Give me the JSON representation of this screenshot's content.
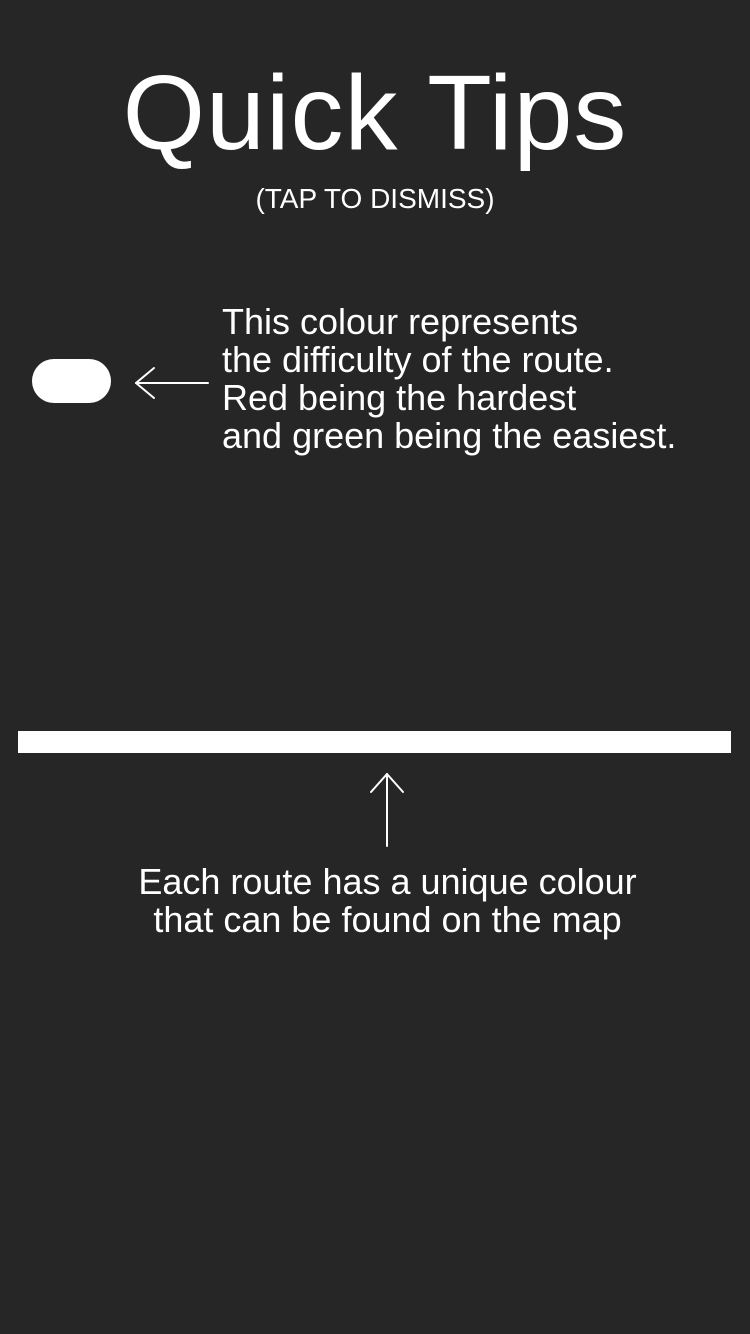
{
  "title": "Quick Tips",
  "subtitle": "(TAP TO DISMISS)",
  "difficulty_tip": {
    "lines": [
      "This colour represents",
      "the difficulty of the route.",
      "Red being the hardest",
      "and green being the easiest."
    ]
  },
  "route_tip": {
    "lines": [
      "Each route has a unique colour",
      "that can be found on the map"
    ]
  },
  "colors": {
    "background": "#262626",
    "foreground": "#ffffff"
  },
  "icons": {
    "difficulty_arrow": "arrow-left-icon",
    "route_arrow": "arrow-up-icon"
  }
}
